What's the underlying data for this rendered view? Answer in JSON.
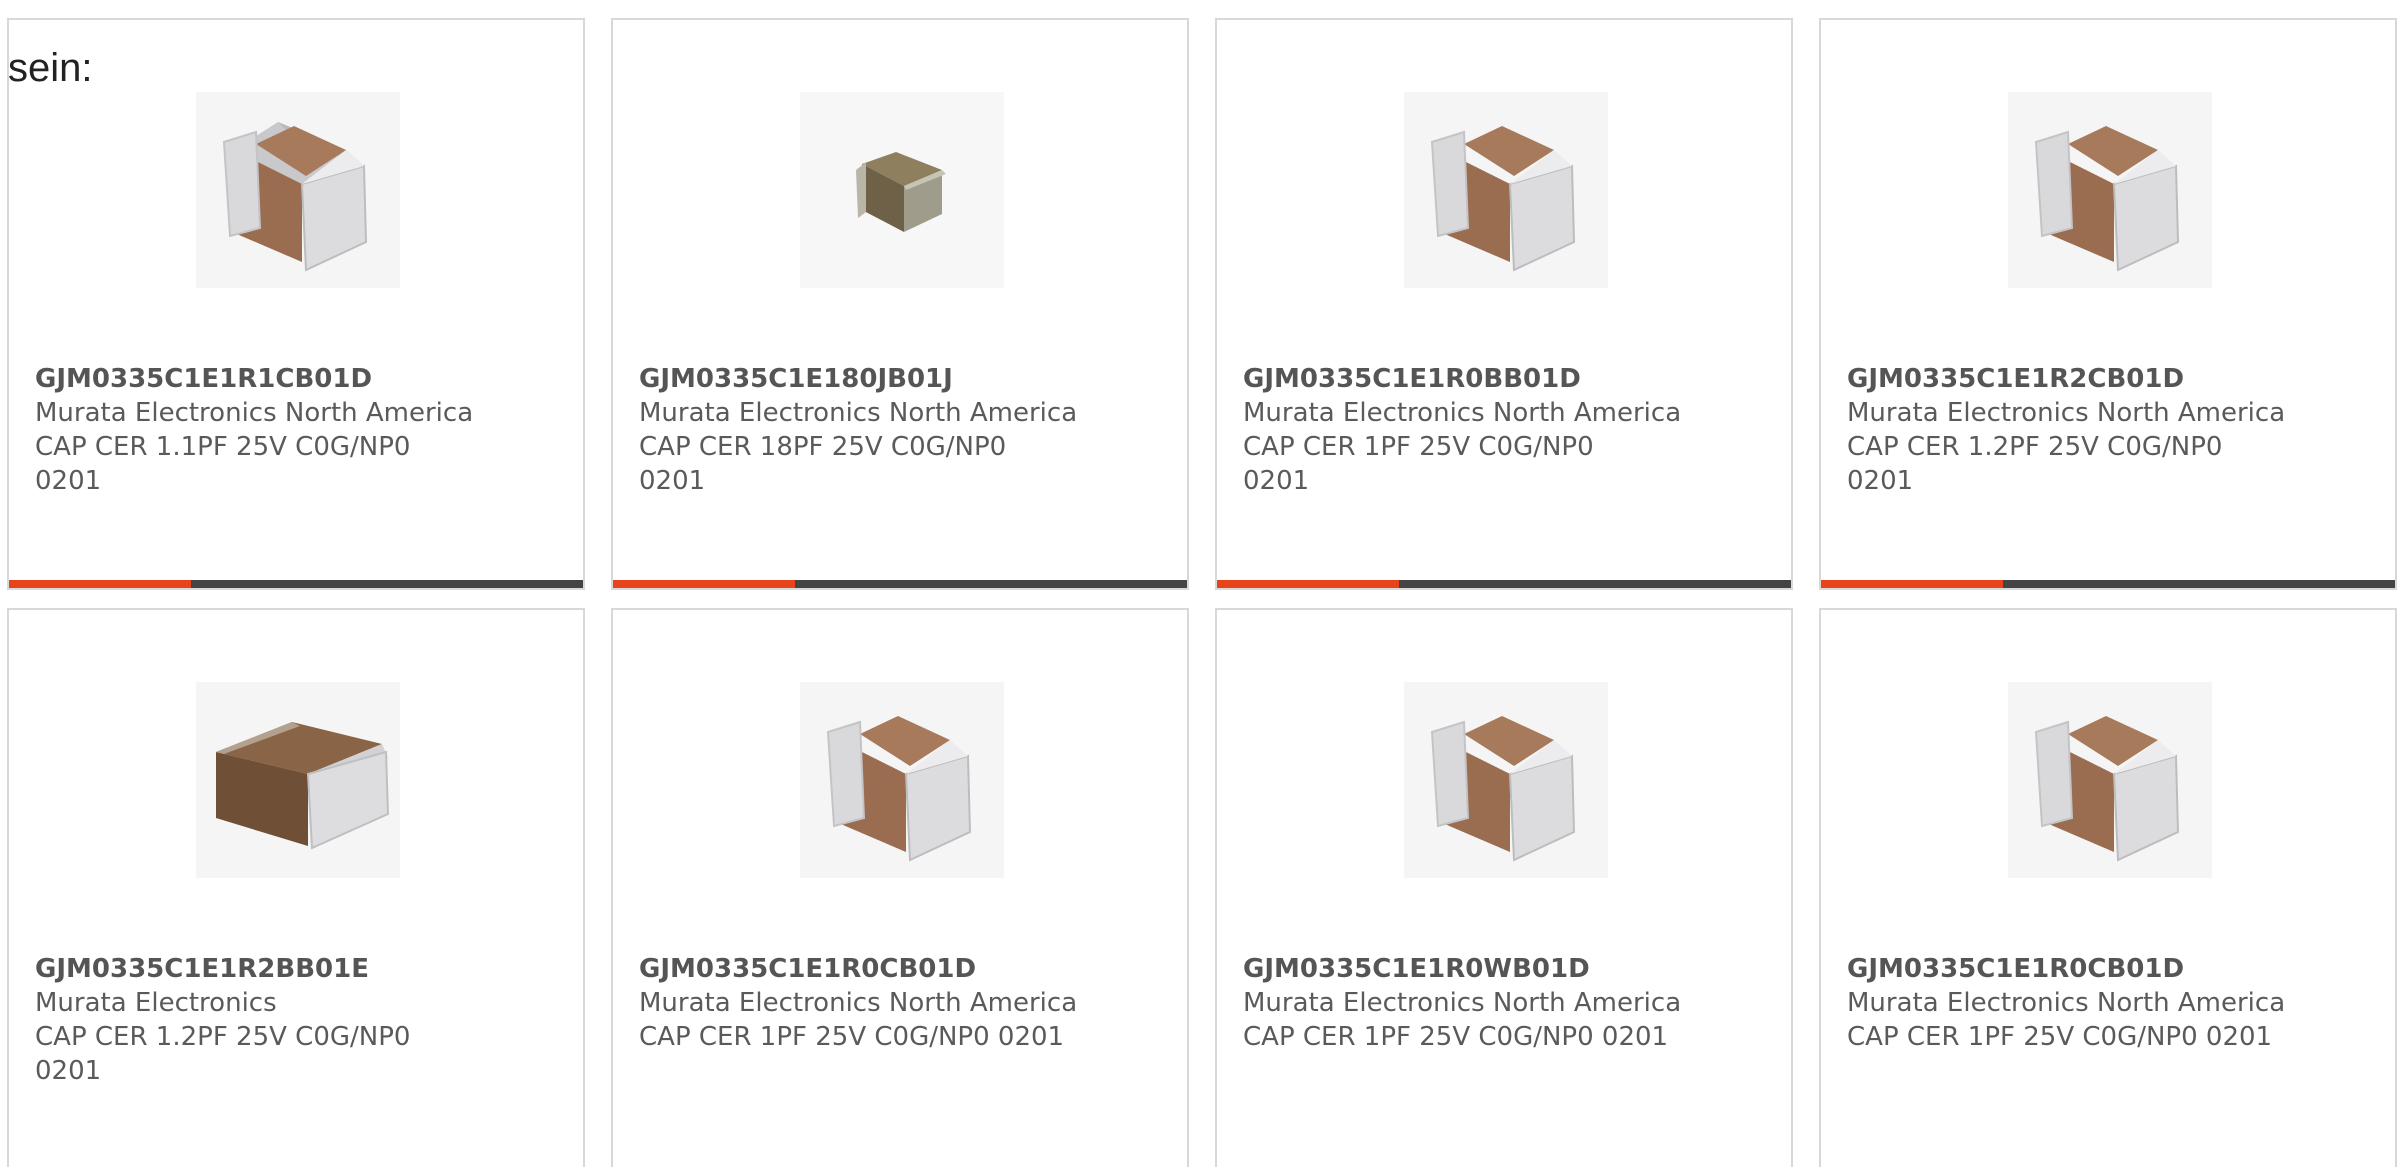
{
  "intro_text": "sein:",
  "accent_color": "#e8441c",
  "bar_color": "#444444",
  "products": [
    {
      "part_number": "GJM0335C1E1R1CB01D",
      "manufacturer": "Murata Electronics North America",
      "description": "CAP CER 1.1PF 25V C0G/NP0 0201",
      "image": "chip-capacitor-large-icon"
    },
    {
      "part_number": "GJM0335C1E180JB01J",
      "manufacturer": "Murata Electronics North America",
      "description": "CAP CER 18PF 25V C0G/NP0 0201",
      "image": "chip-capacitor-small-icon"
    },
    {
      "part_number": "GJM0335C1E1R0BB01D",
      "manufacturer": "Murata Electronics North America",
      "description": "CAP CER 1PF 25V C0G/NP0 0201",
      "image": "chip-capacitor-large-icon"
    },
    {
      "part_number": "GJM0335C1E1R2CB01D",
      "manufacturer": "Murata Electronics North America",
      "description": "CAP CER 1.2PF 25V C0G/NP0 0201",
      "image": "chip-capacitor-large-icon"
    },
    {
      "part_number": "GJM0335C1E1R2BB01E",
      "manufacturer": "Murata Electronics",
      "description": "CAP CER 1.2PF 25V C0G/NP0 0201",
      "image": "chip-capacitor-flat-icon"
    },
    {
      "part_number": "GJM0335C1E1R0CB01D",
      "manufacturer": "Murata Electronics North America",
      "description": "CAP CER 1PF 25V C0G/NP0 0201",
      "image": "chip-capacitor-large-icon"
    },
    {
      "part_number": "GJM0335C1E1R0WB01D",
      "manufacturer": "Murata Electronics North America",
      "description": "CAP CER 1PF 25V C0G/NP0 0201",
      "image": "chip-capacitor-large-icon"
    },
    {
      "part_number": "GJM0335C1E1R0CB01D",
      "manufacturer": "Murata Electronics North America",
      "description": "CAP CER 1PF 25V C0G/NP0 0201",
      "image": "chip-capacitor-large-icon"
    }
  ]
}
